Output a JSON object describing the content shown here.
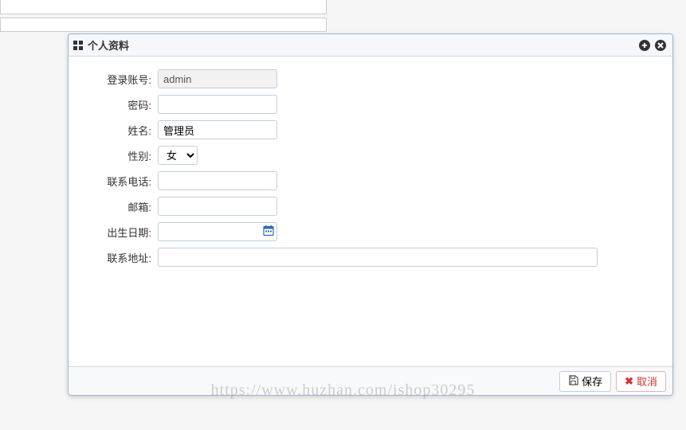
{
  "dialog": {
    "title": "个人资料"
  },
  "form": {
    "account": {
      "label": "登录账号:",
      "value": "admin"
    },
    "password": {
      "label": "密码:",
      "value": ""
    },
    "name": {
      "label": "姓名:",
      "value": "管理员"
    },
    "gender": {
      "label": "性别:",
      "value": "女"
    },
    "phone": {
      "label": "联系电话:",
      "value": ""
    },
    "email": {
      "label": "邮箱:",
      "value": ""
    },
    "birthdate": {
      "label": "出生日期:",
      "value": ""
    },
    "address": {
      "label": "联系地址:",
      "value": ""
    }
  },
  "footer": {
    "save": "保存",
    "cancel": "取消"
  },
  "watermark": "https://www.huzhan.com/ishop30295"
}
